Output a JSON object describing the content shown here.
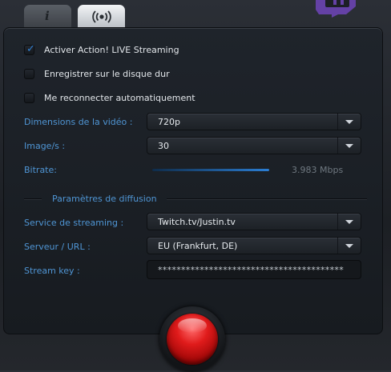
{
  "tabs": {
    "info_glyph": "i",
    "live_icon": "broadcast-icon"
  },
  "brand": {
    "logo": "twitch-logo",
    "color": "#6441a5"
  },
  "options": [
    {
      "label": "Activer Action! LIVE Streaming",
      "checked": true
    },
    {
      "label": "Enregistrer sur le disque dur",
      "checked": false
    },
    {
      "label": "Me reconnecter automatiquement",
      "checked": false
    }
  ],
  "video": {
    "dimensions_label": "Dimensions de la vidéo :",
    "dimensions_value": "720p",
    "fps_label": "Image/s :",
    "fps_value": "30",
    "bitrate_label": "Bitrate:",
    "bitrate_value": "3.983 Mbps",
    "bitrate_level_percent": 100
  },
  "diffusion": {
    "section_title": "Paramètres de diffusion",
    "service_label": "Service de streaming :",
    "service_value": "Twitch.tv/Justin.tv",
    "server_label": "Serveur / URL :",
    "server_value": "EU (Frankfurt, DE)",
    "key_label": "Stream key :",
    "key_value": "****************************************"
  },
  "colors": {
    "accent": "#4f95d4",
    "record": "#e01b1b"
  },
  "record_button": "record-button"
}
